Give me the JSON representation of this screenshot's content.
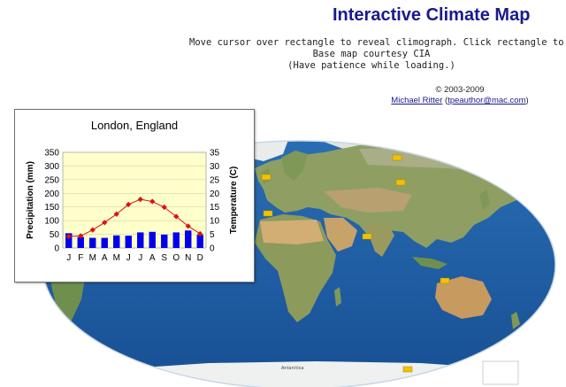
{
  "page": {
    "title": "Interactive Climate Map",
    "instructions": "Move cursor over rectangle to reveal climograph. Click rectangle to view in",
    "base_map": "Base map courtesy CIA",
    "patience": "(Have patience while loading.)",
    "copyright": "© 2003-2009",
    "author": "Michael Ritter",
    "author_email": "tpeauthor@mac.com"
  },
  "map": {
    "labels": {
      "antarctica": "Antarctica"
    },
    "ocean_color": "#1f5fa8",
    "land_color": "#9aa56a",
    "desert_color": "#c9a56a",
    "hotspot_color": "#f2c200"
  },
  "chart_data": {
    "type": "bar",
    "title": "London, England",
    "xlabel": "",
    "ylabel": "Precipitation (mm)",
    "ylabel_right": "Temperature (C)",
    "categories": [
      "J",
      "F",
      "M",
      "A",
      "M",
      "J",
      "J",
      "A",
      "S",
      "O",
      "N",
      "D"
    ],
    "ylim": [
      0,
      350
    ],
    "ylim_right": [
      0,
      35
    ],
    "yticks": [
      0,
      50,
      100,
      150,
      200,
      250,
      300,
      350
    ],
    "yticks_right": [
      0,
      5,
      10,
      15,
      20,
      25,
      30,
      35
    ],
    "grid": true,
    "series": [
      {
        "type": "bar",
        "values": [
          54,
          40,
          37,
          37,
          46,
          45,
          57,
          59,
          49,
          57,
          64,
          48
        ],
        "color": "#0000ee"
      },
      {
        "type": "line",
        "axis": "right",
        "values": [
          4.2,
          4.4,
          6.6,
          9.3,
          12.4,
          15.9,
          17.8,
          17.0,
          14.9,
          11.5,
          8.0,
          5.2
        ],
        "color": "#dd1111"
      }
    ],
    "plot_background": "#ffffcc"
  }
}
